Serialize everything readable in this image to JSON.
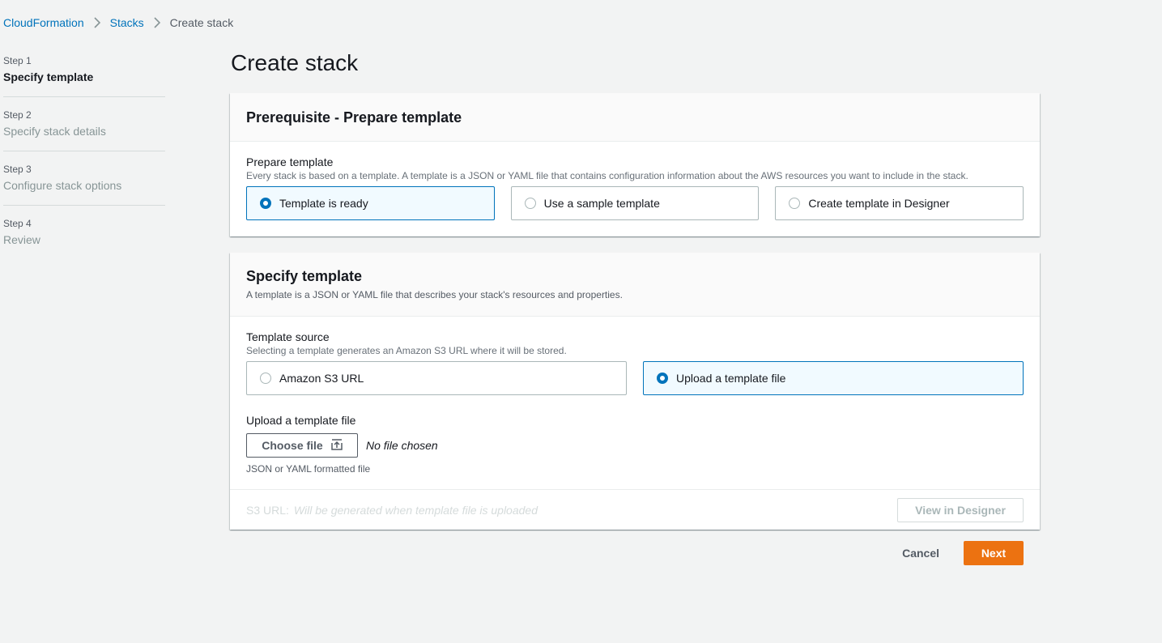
{
  "breadcrumb": {
    "items": [
      "CloudFormation",
      "Stacks"
    ],
    "current": "Create stack"
  },
  "steps": [
    {
      "num": "Step 1",
      "title": "Specify template"
    },
    {
      "num": "Step 2",
      "title": "Specify stack details"
    },
    {
      "num": "Step 3",
      "title": "Configure stack options"
    },
    {
      "num": "Step 4",
      "title": "Review"
    }
  ],
  "page_title": "Create stack",
  "prereq": {
    "header": "Prerequisite - Prepare template",
    "label": "Prepare template",
    "description": "Every stack is based on a template. A template is a JSON or YAML file that contains configuration information about the AWS resources you want to include in the stack.",
    "options": [
      "Template is ready",
      "Use a sample template",
      "Create template in Designer"
    ],
    "selected": "Template is ready"
  },
  "specify": {
    "header": "Specify template",
    "header_desc": "A template is a JSON or YAML file that describes your stack's resources and properties.",
    "source_label": "Template source",
    "source_desc": "Selecting a template generates an Amazon S3 URL where it will be stored.",
    "options": [
      "Amazon S3 URL",
      "Upload a template file"
    ],
    "selected": "Upload a template file",
    "upload_label": "Upload a template file",
    "choose_button": "Choose file",
    "no_file": "No file chosen",
    "hint": "JSON or YAML formatted file",
    "s3url_label": "S3 URL:",
    "s3url_value": "Will be generated when template file is uploaded",
    "designer_button": "View in Designer"
  },
  "actions": {
    "cancel": "Cancel",
    "next": "Next"
  },
  "colors": {
    "link": "#0073bb",
    "primary_button": "#ec7211",
    "selected_tile_bg": "#f1faff",
    "background": "#f2f3f3"
  }
}
